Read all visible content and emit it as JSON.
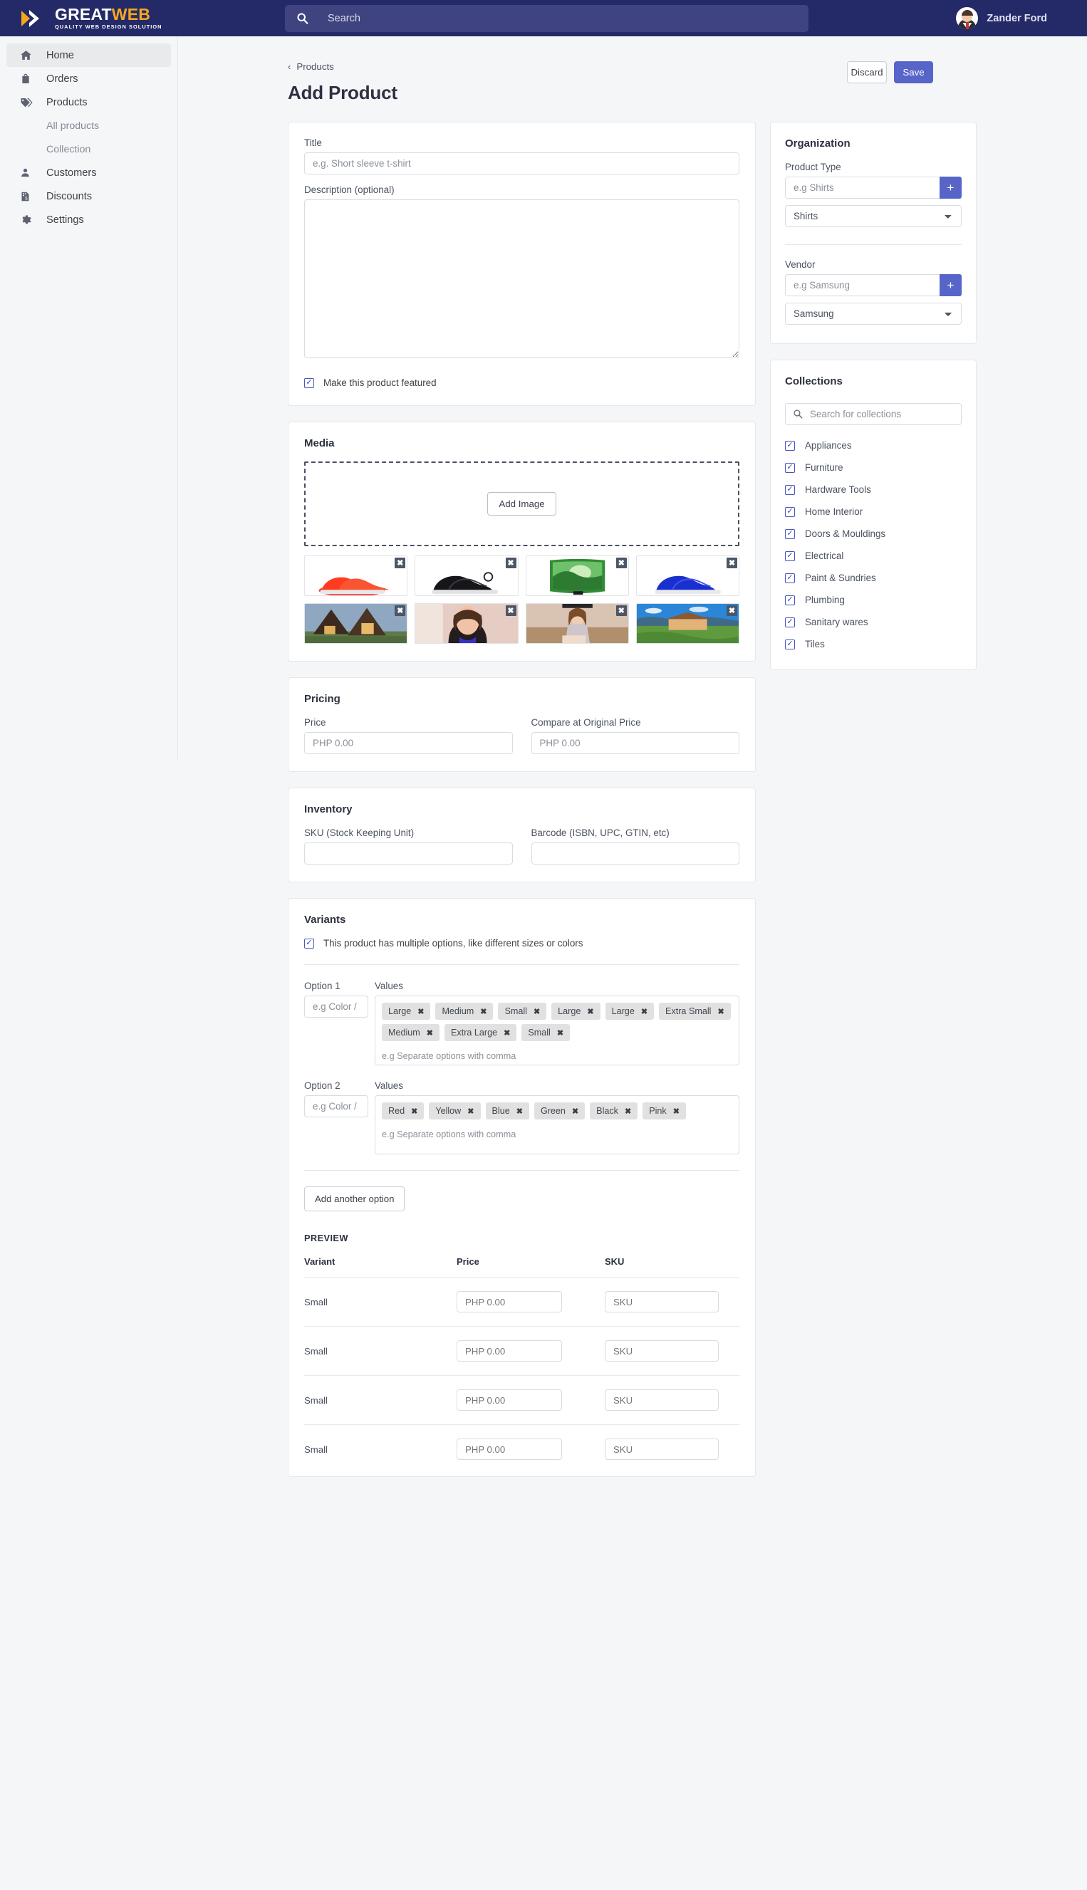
{
  "brand": {
    "logo_primary": "GREAT",
    "logo_accent": "WEB",
    "logo_tagline": "QUALITY WEB DESIGN SOLUTION",
    "accent_color": "#f5a81c",
    "topbar_color": "#242a67",
    "primary_button_color": "#5765c8"
  },
  "header": {
    "search_placeholder": "Search",
    "search_icon": "search-icon",
    "user_name": "Zander Ford",
    "avatar_icon": "user-avatar"
  },
  "sidebar": {
    "items": [
      {
        "label": "Home",
        "icon": "home-icon",
        "active": true
      },
      {
        "label": "Orders",
        "icon": "bag-icon",
        "active": false
      },
      {
        "label": "Products",
        "icon": "tag-icon",
        "active": false
      },
      {
        "label": "Customers",
        "icon": "person-icon",
        "active": false
      },
      {
        "label": "Discounts",
        "icon": "discount-document-icon",
        "active": false
      },
      {
        "label": "Settings",
        "icon": "gear-icon",
        "active": false
      }
    ],
    "sub_items": [
      {
        "label": "All products"
      },
      {
        "label": "Collection"
      }
    ]
  },
  "page": {
    "breadcrumb": "Products",
    "breadcrumb_icon": "chevron-left-icon",
    "title": "Add Product",
    "discard_label": "Discard",
    "save_label": "Save"
  },
  "product_form": {
    "title_label": "Title",
    "title_placeholder": "e.g. Short sleeve t-shirt",
    "title_value": "",
    "description_label": "Description (optional)",
    "description_value": "",
    "featured_label": "Make this product featured",
    "featured_checked": true
  },
  "media": {
    "title": "Media",
    "add_image_label": "Add Image",
    "remove_icon": "close-icon",
    "thumbnails": [
      {
        "alt": "red-running-shoes",
        "kind": "shoe-red"
      },
      {
        "alt": "black-running-shoes",
        "kind": "shoe-black"
      },
      {
        "alt": "curved-tv-forest-screen",
        "kind": "tv"
      },
      {
        "alt": "blue-running-shoes",
        "kind": "shoe-blue"
      },
      {
        "alt": "wooden-villa-houses",
        "kind": "villa"
      },
      {
        "alt": "woman-portrait-black-top",
        "kind": "portrait1"
      },
      {
        "alt": "woman-sitting-on-couch",
        "kind": "portrait2"
      },
      {
        "alt": "resort-building-on-hill",
        "kind": "resort"
      }
    ]
  },
  "pricing": {
    "title": "Pricing",
    "price_label": "Price",
    "price_placeholder": "PHP 0.00",
    "compare_label": "Compare at Original Price",
    "compare_placeholder": "PHP 0.00"
  },
  "inventory": {
    "title": "Inventory",
    "sku_label": "SKU (Stock Keeping Unit)",
    "sku_value": "",
    "barcode_label": "Barcode (ISBN, UPC, GTIN, etc)",
    "barcode_value": ""
  },
  "variants": {
    "title": "Variants",
    "multi_option_label": "This product has multiple options, like different sizes or colors",
    "multi_option_checked": true,
    "values_label": "Values",
    "option_placeholder": "e.g Color / Size",
    "values_hint": "e.g Separate options with comma",
    "remove_icon": "close-icon",
    "options": [
      {
        "label": "Option 1",
        "value": "",
        "tags": [
          "Large",
          "Medium",
          "Small",
          "Large",
          "Large",
          "Extra Small",
          "Medium",
          "Extra Large",
          "Small"
        ]
      },
      {
        "label": "Option 2",
        "value": "",
        "tags": [
          "Red",
          "Yellow",
          "Blue",
          "Green",
          "Black",
          "Pink"
        ]
      }
    ],
    "add_option_label": "Add another option"
  },
  "preview": {
    "title": "PREVIEW",
    "columns": [
      "Variant",
      "Price",
      "SKU"
    ],
    "price_placeholder": "PHP 0.00",
    "sku_placeholder": "SKU",
    "rows": [
      {
        "variant": "Small",
        "price": "",
        "sku": ""
      },
      {
        "variant": "Small",
        "price": "",
        "sku": ""
      },
      {
        "variant": "Small",
        "price": "",
        "sku": ""
      },
      {
        "variant": "Small",
        "price": "",
        "sku": ""
      }
    ]
  },
  "organization": {
    "title": "Organization",
    "product_type_label": "Product Type",
    "product_type_placeholder": "e.g Shirts",
    "product_type_value": "",
    "product_type_selected": "Shirts",
    "vendor_label": "Vendor",
    "vendor_placeholder": "e.g Samsung",
    "vendor_value": "",
    "vendor_selected": "Samsung",
    "add_icon": "plus-icon"
  },
  "collections": {
    "title": "Collections",
    "search_placeholder": "Search for collections",
    "search_icon": "search-icon",
    "items": [
      {
        "label": "Appliances",
        "checked": true
      },
      {
        "label": "Furniture",
        "checked": true
      },
      {
        "label": "Hardware Tools",
        "checked": true
      },
      {
        "label": "Home Interior",
        "checked": true
      },
      {
        "label": "Doors & Mouldings",
        "checked": true
      },
      {
        "label": "Electrical",
        "checked": true
      },
      {
        "label": "Paint & Sundries",
        "checked": true
      },
      {
        "label": "Plumbing",
        "checked": true
      },
      {
        "label": "Sanitary wares",
        "checked": true
      },
      {
        "label": "Tiles",
        "checked": true
      }
    ]
  }
}
